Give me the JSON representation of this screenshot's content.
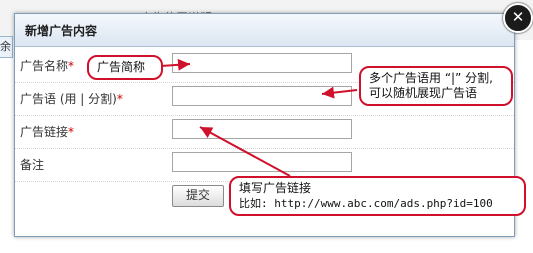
{
  "background": {
    "left_fragment": "余",
    "header_text": "广告位置说明"
  },
  "dialog": {
    "title": "新增广告内容",
    "close_glyph": "✕",
    "fields": {
      "name_label": "广告名称",
      "text_label": "广告语 (用 | 分割)",
      "link_label": "广告链接",
      "remark_label": "备注",
      "required_mark": "*"
    },
    "submit_label": "提交"
  },
  "annotations": {
    "name_note": "广告简称",
    "text_note_line1": "多个广告语用 “|” 分割,",
    "text_note_line2": "可以随机展现广告语",
    "link_note_line1": "填写广告链接",
    "link_note_line2": "比如: http://www.abc.com/ads.php?id=100"
  },
  "colors": {
    "annotation_red": "#d0112b",
    "required_red": "#cc0000"
  }
}
